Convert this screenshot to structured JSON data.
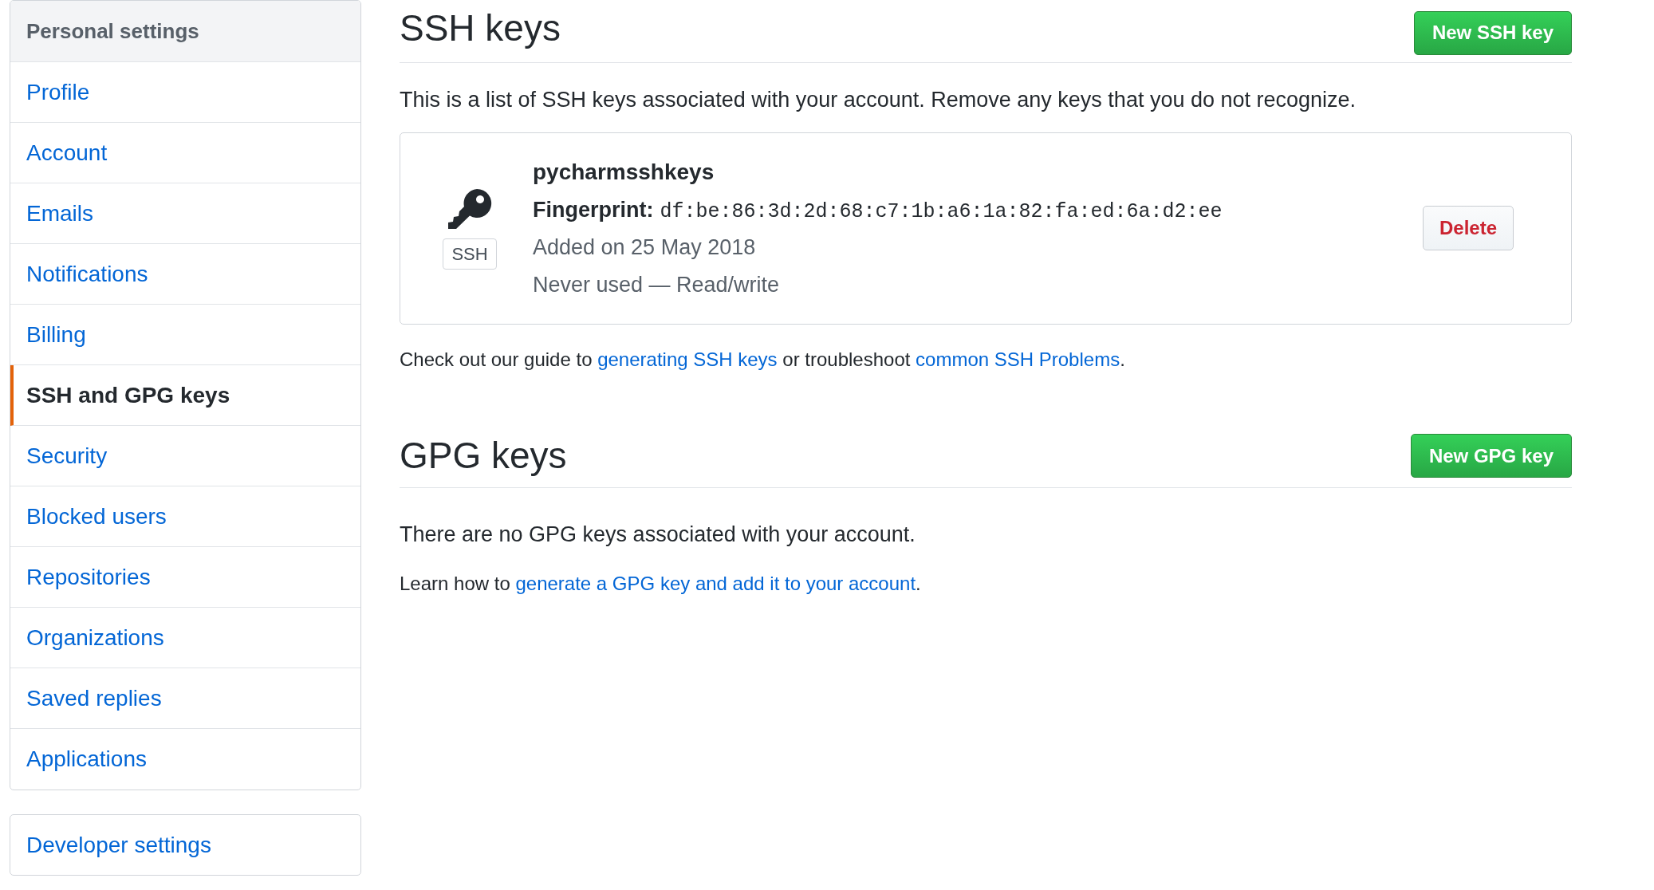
{
  "sidebar": {
    "header": "Personal settings",
    "items": [
      {
        "label": "Profile",
        "selected": false
      },
      {
        "label": "Account",
        "selected": false
      },
      {
        "label": "Emails",
        "selected": false
      },
      {
        "label": "Notifications",
        "selected": false
      },
      {
        "label": "Billing",
        "selected": false
      },
      {
        "label": "SSH and GPG keys",
        "selected": true
      },
      {
        "label": "Security",
        "selected": false
      },
      {
        "label": "Blocked users",
        "selected": false
      },
      {
        "label": "Repositories",
        "selected": false
      },
      {
        "label": "Organizations",
        "selected": false
      },
      {
        "label": "Saved replies",
        "selected": false
      },
      {
        "label": "Applications",
        "selected": false
      }
    ],
    "developer_settings": "Developer settings"
  },
  "ssh": {
    "title": "SSH keys",
    "button": "New SSH key",
    "description": "This is a list of SSH keys associated with your account. Remove any keys that you do not recognize.",
    "keys": [
      {
        "badge": "SSH",
        "name": "pycharmsshkeys",
        "fingerprint_label": "Fingerprint:",
        "fingerprint": "df:be:86:3d:2d:68:c7:1b:a6:1a:82:fa:ed:6a:d2:ee",
        "added": "Added on 25 May 2018",
        "usage": "Never used — Read/write",
        "delete": "Delete"
      }
    ],
    "guide": [
      {
        "kind": "text",
        "text": "Check out our guide to "
      },
      {
        "kind": "link",
        "text": "generating SSH keys"
      },
      {
        "kind": "text",
        "text": " or troubleshoot "
      },
      {
        "kind": "link",
        "text": "common SSH Problems"
      },
      {
        "kind": "text",
        "text": "."
      }
    ]
  },
  "gpg": {
    "title": "GPG keys",
    "button": "New GPG key",
    "empty": "There are no GPG keys associated with your account.",
    "learn": [
      {
        "kind": "text",
        "text": "Learn how to "
      },
      {
        "kind": "link",
        "text": "generate a GPG key and add it to your account"
      },
      {
        "kind": "text",
        "text": "."
      }
    ]
  }
}
